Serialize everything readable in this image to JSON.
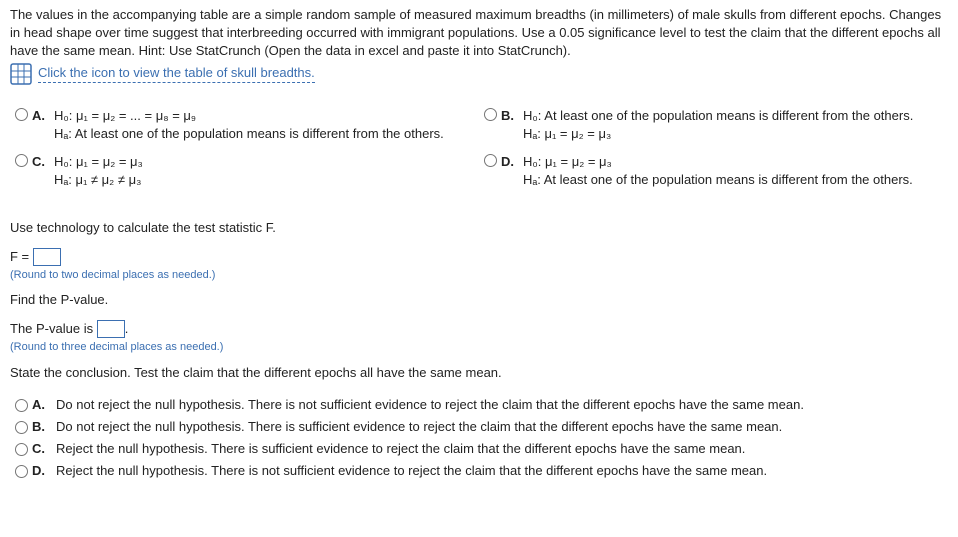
{
  "intro": "The values in the accompanying table are a simple random sample of measured maximum breadths (in millimeters) of male skulls from different epochs. Changes in head shape over time suggest that interbreeding occurred with immigrant populations. Use a 0.05 significance level to test the claim that the different epochs all have the same mean. Hint: Use StatCrunch (Open the data in excel and paste it into StatCrunch).",
  "icon_link_text": "Click the icon to view the table of skull breadths.",
  "hypo_options": {
    "A": {
      "letter": "A.",
      "line1": "H₀: μ₁ = μ₂ = ... = μ₈ = μ₉",
      "line2": "Hₐ: At least one of the population means is different from the others."
    },
    "B": {
      "letter": "B.",
      "line1": "H₀: At least one of the population means is different from the others.",
      "line2": "Hₐ: μ₁ = μ₂ = μ₃"
    },
    "C": {
      "letter": "C.",
      "line1": "H₀: μ₁ = μ₂ = μ₃",
      "line2": "Hₐ: μ₁ ≠ μ₂ ≠ μ₃"
    },
    "D": {
      "letter": "D.",
      "line1": "H₀: μ₁ = μ₂ = μ₃",
      "line2": "Hₐ: At least one of the population means is different from the others."
    }
  },
  "prompt_teststat": "Use technology to calculate the test statistic F.",
  "f_equals": "F = ",
  "hint_f": "(Round to two decimal places as needed.)",
  "prompt_pvalue": "Find the P-value.",
  "pvalue_line_pre": "The P-value is ",
  "pvalue_line_post": ".",
  "hint_p": "(Round to three decimal places as needed.)",
  "prompt_conclusion": "State the conclusion. Test the claim that the different epochs all have the same mean.",
  "conc_options": {
    "A": {
      "letter": "A.",
      "text": "Do not reject the null hypothesis. There is not sufficient evidence to reject the claim that the different epochs have the same mean."
    },
    "B": {
      "letter": "B.",
      "text": "Do not reject the null hypothesis. There is sufficient evidence to reject the claim that the different epochs have the same mean."
    },
    "C": {
      "letter": "C.",
      "text": "Reject the null hypothesis. There is sufficient evidence to reject the claim that the different epochs have the same mean."
    },
    "D": {
      "letter": "D.",
      "text": "Reject the null hypothesis. There is not sufficient evidence to reject the claim that the different epochs have the same mean."
    }
  }
}
